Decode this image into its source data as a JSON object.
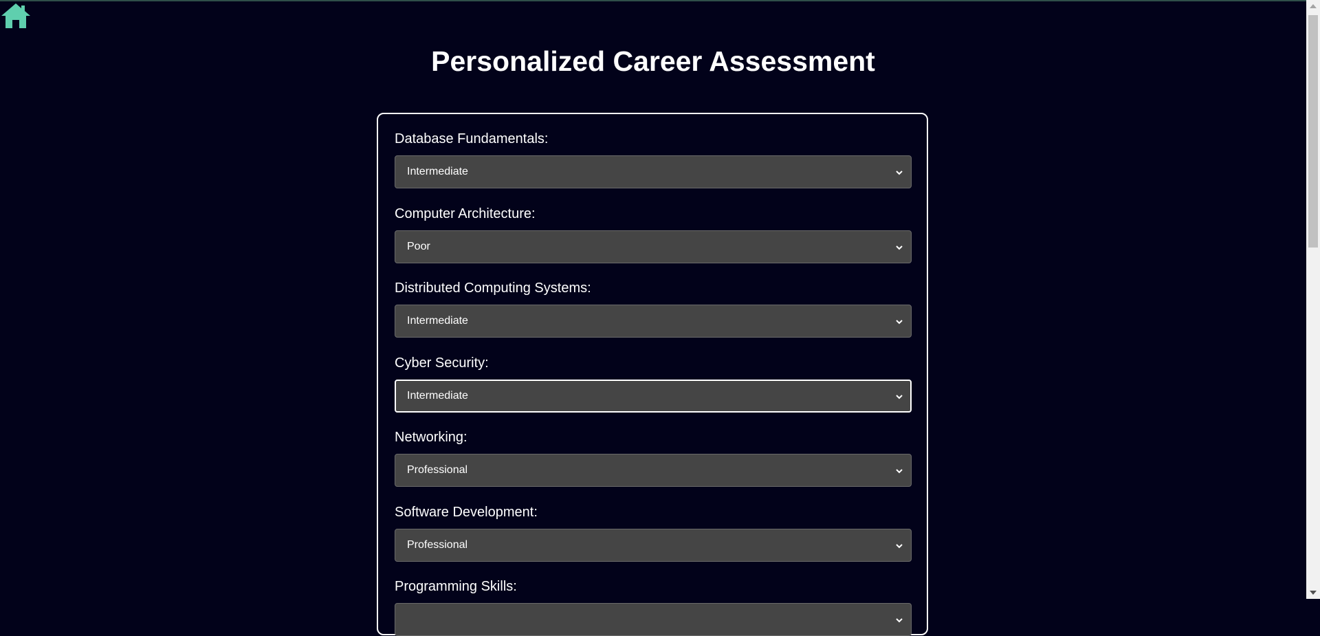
{
  "page": {
    "title": "Personalized Career Assessment"
  },
  "nav": {
    "home_icon": "home-icon",
    "home_color": "#5fcfae"
  },
  "form": {
    "fields": [
      {
        "label": "Database Fundamentals:",
        "value": "Intermediate"
      },
      {
        "label": "Computer Architecture:",
        "value": "Poor"
      },
      {
        "label": "Distributed Computing Systems:",
        "value": "Intermediate"
      },
      {
        "label": "Cyber Security:",
        "value": "Intermediate"
      },
      {
        "label": "Networking:",
        "value": "Professional"
      },
      {
        "label": "Software Development:",
        "value": "Professional"
      },
      {
        "label": "Programming Skills:",
        "value": ""
      }
    ]
  },
  "colors": {
    "background": "#02021a",
    "select_background": "#454545",
    "text": "#ffffff",
    "card_border": "#ffffff"
  }
}
